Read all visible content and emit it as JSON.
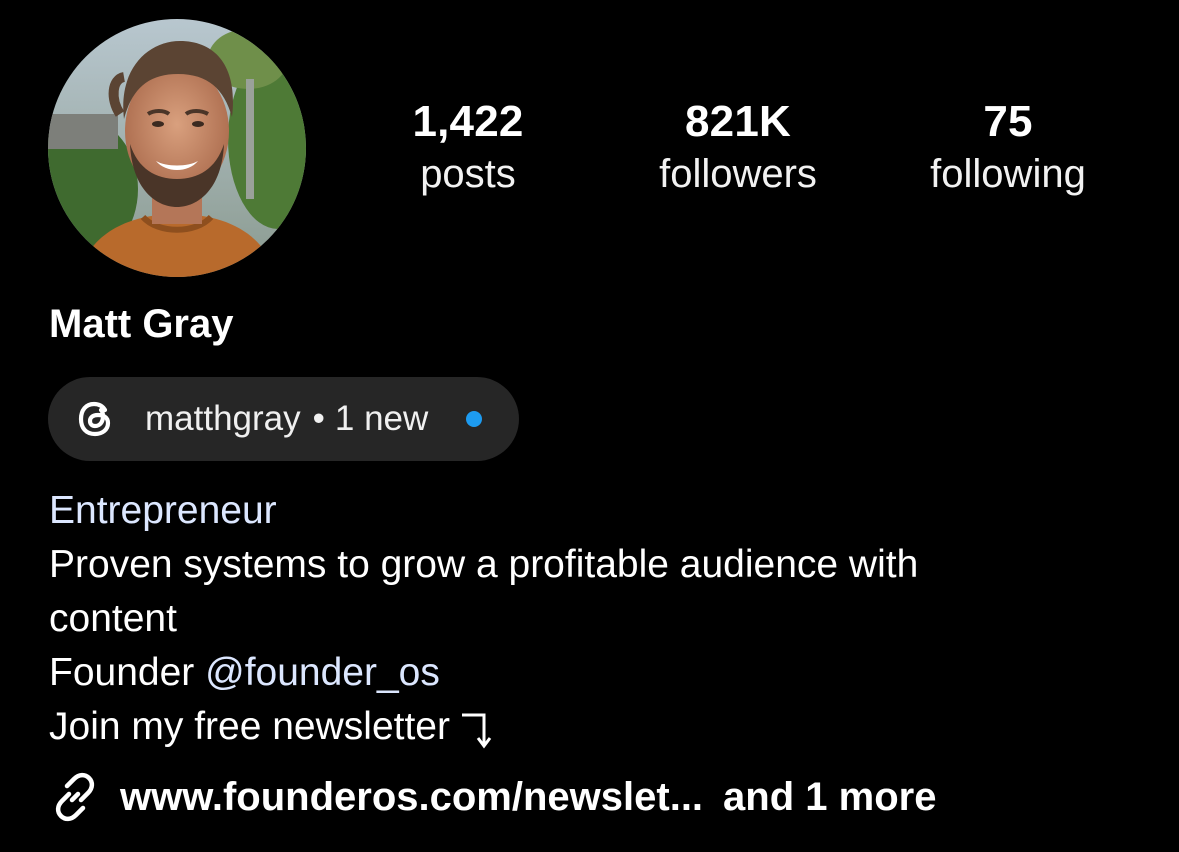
{
  "profile": {
    "name": "Matt Gray",
    "avatar_icon": "profile-photo"
  },
  "stats": {
    "posts": {
      "value": "1,422",
      "label": "posts"
    },
    "followers": {
      "value": "821K",
      "label": "followers"
    },
    "following": {
      "value": "75",
      "label": "following"
    }
  },
  "threads": {
    "icon": "threads-icon",
    "handle": "matthgray",
    "separator": "•",
    "new_label": "1 new",
    "dot_color": "#1d9bf0"
  },
  "bio": {
    "category": "Entrepreneur",
    "line1": "Proven systems to grow a profitable audience with",
    "line2": "content",
    "founder_prefix": "Founder",
    "mention": "@founder_os",
    "newsletter": "Join my free newsletter"
  },
  "link": {
    "icon": "link-icon",
    "url_text": "www.founderos.com/newslet...",
    "more_text": "and 1 more"
  },
  "colors": {
    "background": "#000000",
    "pill": "#262626",
    "link_accent": "#dce7ff",
    "notify": "#1d9bf0"
  }
}
